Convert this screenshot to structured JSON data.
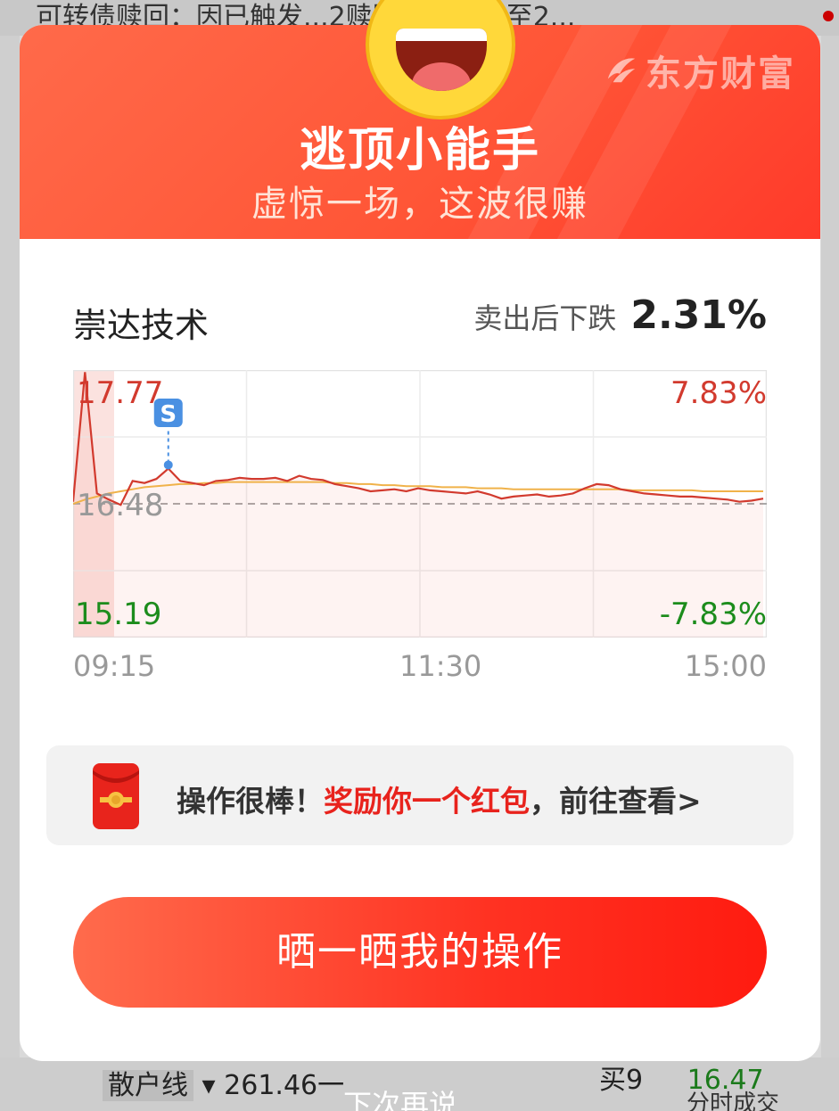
{
  "background": {
    "top_banner": "可转债赎回：因已触发...2赎回条款，截至2...",
    "ticker_select": "散户线",
    "ticker_value": "261.46一",
    "right_label": "买9",
    "right_value": "16.47",
    "bottom_center": "下次再说",
    "bottom_right": "分时成交"
  },
  "modal": {
    "brand": "东方财富",
    "title": "逃顶小能手",
    "subtitle": "虚惊一场，这波很赚",
    "stock_name": "崇达技术",
    "drop_label": "卖出后下跌",
    "drop_value": "2.31%",
    "reward": {
      "prefix": "操作很棒！",
      "highlight": "奖励你一个红包",
      "suffix": "，前往查看>"
    },
    "share_button": "晒一晒我的操作"
  },
  "chart_data": {
    "type": "line",
    "x_ticks": [
      "09:15",
      "11:30",
      "15:00"
    ],
    "y_left_labels": {
      "top": "17.77",
      "mid": "16.48",
      "bottom": "15.19"
    },
    "y_right_labels": {
      "top": "7.83%",
      "bottom": "-7.83%"
    },
    "ylim": [
      15.19,
      17.77
    ],
    "prev_close": 16.48,
    "sell_marker": {
      "label": "S",
      "index": 8,
      "price": 16.82
    },
    "series": [
      {
        "role": "price",
        "color": "#d23a2e",
        "values": [
          16.5,
          17.75,
          16.58,
          16.52,
          16.47,
          16.7,
          16.68,
          16.72,
          16.82,
          16.7,
          16.68,
          16.66,
          16.7,
          16.71,
          16.73,
          16.72,
          16.72,
          16.73,
          16.7,
          16.75,
          16.72,
          16.71,
          16.67,
          16.65,
          16.63,
          16.6,
          16.61,
          16.62,
          16.6,
          16.63,
          16.61,
          16.6,
          16.59,
          16.58,
          16.6,
          16.57,
          16.53,
          16.55,
          16.56,
          16.57,
          16.55,
          16.56,
          16.58,
          16.63,
          16.67,
          16.66,
          16.62,
          16.6,
          16.58,
          16.57,
          16.56,
          16.55,
          16.55,
          16.54,
          16.53,
          16.52,
          16.5,
          16.51,
          16.53
        ]
      },
      {
        "role": "average",
        "color": "#f0b24a",
        "values": [
          16.48,
          16.52,
          16.55,
          16.58,
          16.6,
          16.62,
          16.64,
          16.65,
          16.66,
          16.67,
          16.67,
          16.68,
          16.68,
          16.69,
          16.69,
          16.69,
          16.69,
          16.69,
          16.69,
          16.69,
          16.69,
          16.69,
          16.68,
          16.68,
          16.67,
          16.67,
          16.66,
          16.66,
          16.65,
          16.65,
          16.65,
          16.64,
          16.64,
          16.64,
          16.63,
          16.63,
          16.63,
          16.62,
          16.62,
          16.62,
          16.62,
          16.62,
          16.62,
          16.62,
          16.62,
          16.62,
          16.62,
          16.61,
          16.61,
          16.61,
          16.61,
          16.61,
          16.61,
          16.6,
          16.6,
          16.6,
          16.6,
          16.6,
          16.6
        ]
      }
    ]
  }
}
